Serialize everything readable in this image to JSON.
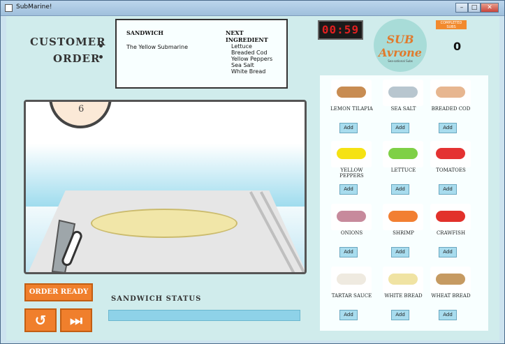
{
  "window": {
    "title": "SubMarine!"
  },
  "labels": {
    "customer": "CUSTOMER",
    "order": "ORDER"
  },
  "order": {
    "sandwich_header": "SANDWICH",
    "next_header": "NEXT INGREDIENT",
    "sandwich_name": "The Yellow Submarine",
    "ingredients": [
      "Lettuce",
      "Breaded Cod",
      "Yellow Peppers",
      "Sea Salt",
      "White Bread"
    ]
  },
  "timer": "00:59",
  "logo": {
    "name": "SUB Avrone",
    "tagline": "Sea-sational Subs"
  },
  "completed": {
    "label": "COMPLETED SUBS",
    "count": "0"
  },
  "scene": {
    "clock_number": "6"
  },
  "controls": {
    "order_ready": "ORDER READY",
    "reset_icon": "↺",
    "skip_icon": "⏭",
    "status_label": "SANDWICH STATUS",
    "progress_fraction": 0.0
  },
  "ingredients": [
    {
      "name": "LEMON TILAPIA",
      "add": "Add",
      "color": "#c88c52"
    },
    {
      "name": "SEA SALT",
      "add": "Add",
      "color": "#b8c6cf"
    },
    {
      "name": "BREADED COD",
      "add": "Add",
      "color": "#e7b690"
    },
    {
      "name": "YELLOW PEPPERS",
      "add": "Add",
      "color": "#f5e213"
    },
    {
      "name": "LETTUCE",
      "add": "Add",
      "color": "#7fd046"
    },
    {
      "name": "TOMATOES",
      "add": "Add",
      "color": "#e43232"
    },
    {
      "name": "ONIONS",
      "add": "Add",
      "color": "#c78a9c"
    },
    {
      "name": "SHRIMP",
      "add": "Add",
      "color": "#f27f32"
    },
    {
      "name": "CRAWFISH",
      "add": "Add",
      "color": "#e2312b"
    },
    {
      "name": "TARTAR SAUCE",
      "add": "Add",
      "color": "#efeae0"
    },
    {
      "name": "WHITE BREAD",
      "add": "Add",
      "color": "#f0e3a3"
    },
    {
      "name": "WHEAT BREAD",
      "add": "Add",
      "color": "#c69a62"
    }
  ]
}
